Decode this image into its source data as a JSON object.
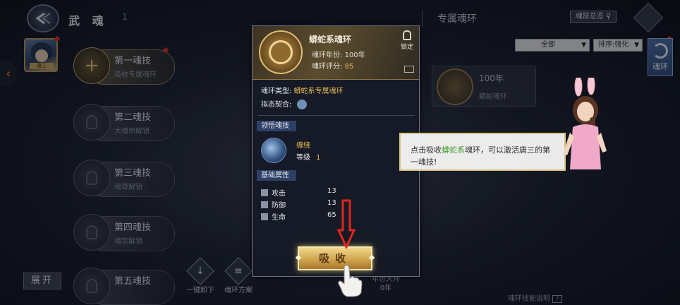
{
  "header": {
    "title": "武 魂",
    "page_indicator": "1"
  },
  "character": {
    "avatar_tag": "唐三"
  },
  "ring_slots": [
    {
      "name": "第一魂技",
      "desc": "吸收专属魂环",
      "active": true
    },
    {
      "name": "第二魂技",
      "desc": "大魂师解锁",
      "active": false
    },
    {
      "name": "第三魂技",
      "desc": "魂尊解锁",
      "active": false
    },
    {
      "name": "第四魂技",
      "desc": "魂宗解锁",
      "active": false
    },
    {
      "name": "第五魂技",
      "desc": "",
      "active": false
    }
  ],
  "bottom_bar": {
    "expand_label": "展开",
    "unequip_all_label": "一键卸下",
    "ring_plan_label": "魂环方案"
  },
  "right_panel": {
    "title": "专属魂环",
    "overview_label": "魂技总览",
    "filter_all": "全部",
    "filter_sort": "排序:强化",
    "soul_tab_label": "魂环",
    "ring_card": {
      "years": "100年",
      "name": "蟒蛇魂环"
    },
    "master_label": "年份大师",
    "master_value": "0年",
    "skill_desc_label": "魂环技能说明"
  },
  "popup": {
    "ring_name": "蟒蛇系魂环",
    "year_label": "魂环年份:",
    "year_value": "100年",
    "score_label": "魂环评分:",
    "score_value": "85",
    "lock_label": "锁定",
    "type_label": "魂环类型:",
    "type_value": "蟒蛇系专属魂环",
    "contract_label": "拟态契合:",
    "section_skill": "领悟魂技",
    "skill_name": "缠绕",
    "skill_level_label": "等级",
    "skill_level_value": "1",
    "section_attr": "基础属性",
    "stats": [
      {
        "label": "攻击",
        "value": "13"
      },
      {
        "label": "防御",
        "value": "13"
      },
      {
        "label": "生命",
        "value": "65"
      }
    ],
    "absorb_label": "吸收"
  },
  "guide": {
    "text_before": "点击吸收",
    "text_highlight": "蟒蛇系",
    "text_after": "魂环，可以激活唐三的第一魂技!"
  },
  "colors": {
    "gold": "#e6b955",
    "highlight_green": "#3e9a2c",
    "arrow_red": "#e0251d"
  }
}
